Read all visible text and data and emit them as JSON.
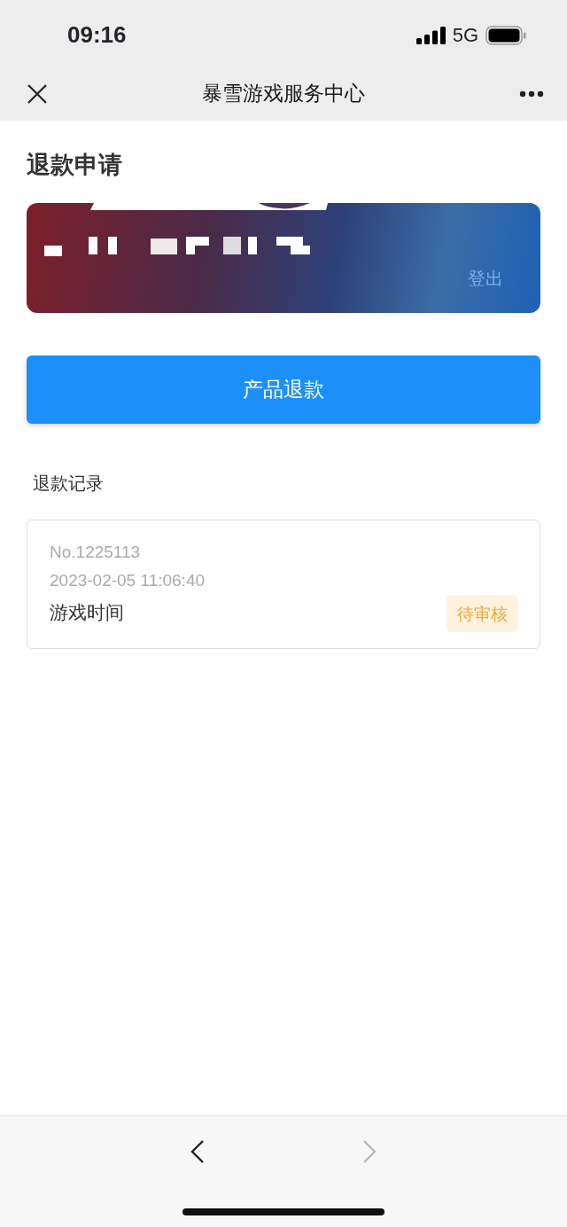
{
  "status_bar": {
    "time": "09:16",
    "network": "5G"
  },
  "nav": {
    "title": "暴雪游戏服务中心"
  },
  "page_title": "退款申请",
  "account_banner": {
    "logout": "登出"
  },
  "refund_button": "产品退款",
  "records_title": "退款记录",
  "records": [
    {
      "number": "No.1225113",
      "date": "2023-02-05 11:06:40",
      "product": "游戏时间",
      "status": "待审核",
      "color": "#f0a63a"
    }
  ],
  "browser_toolbar": {
    "back_disabled": false,
    "forward_disabled": true
  }
}
